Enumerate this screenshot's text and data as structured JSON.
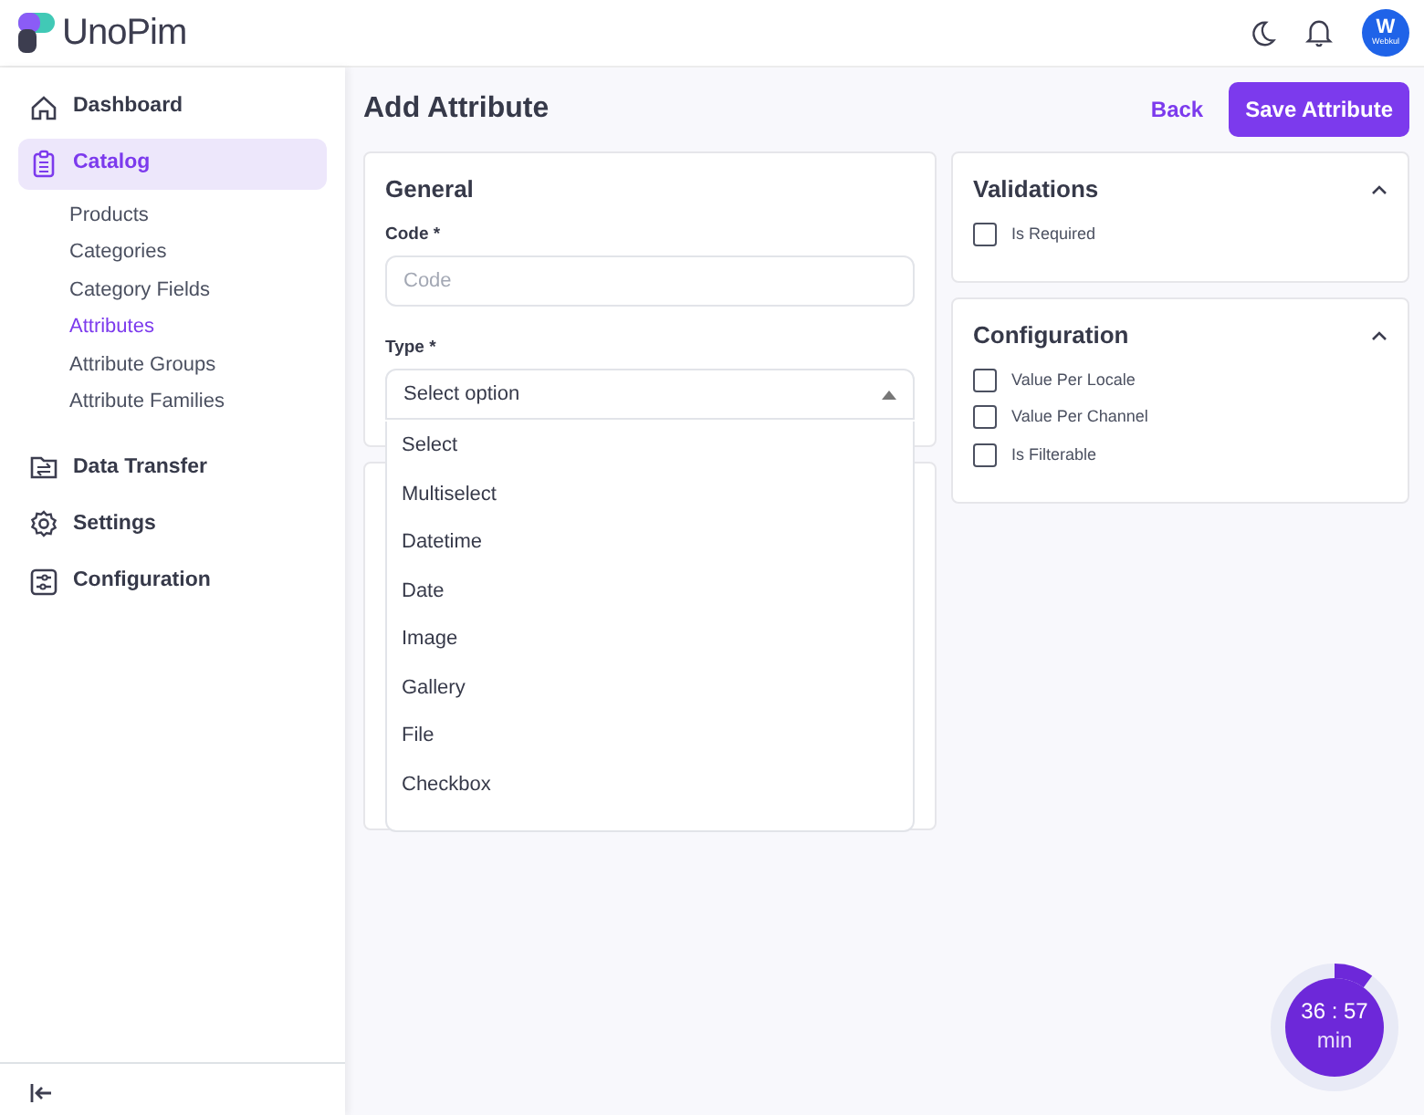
{
  "header": {
    "logo": "UnoPim",
    "avatar": {
      "letter": "W",
      "caption": "Webkul"
    }
  },
  "sidebar": {
    "items": [
      {
        "label": "Dashboard",
        "selected": false
      },
      {
        "label": "Catalog",
        "selected": true,
        "children": [
          {
            "label": "Products",
            "selected": false
          },
          {
            "label": "Categories",
            "selected": false
          },
          {
            "label": "Category Fields",
            "selected": false
          },
          {
            "label": "Attributes",
            "selected": true
          },
          {
            "label": "Attribute Groups",
            "selected": false
          },
          {
            "label": "Attribute Families",
            "selected": false
          }
        ]
      },
      {
        "label": "Data Transfer",
        "selected": false
      },
      {
        "label": "Settings",
        "selected": false
      },
      {
        "label": "Configuration",
        "selected": false
      }
    ]
  },
  "page": {
    "title": "Add Attribute",
    "back": "Back",
    "save": "Save Attribute"
  },
  "general": {
    "title": "General",
    "code_label": "Code *",
    "code_placeholder": "Code",
    "type_label": "Type *",
    "type_value": "Select option",
    "expanded": true,
    "options": [
      "Select",
      "Multiselect",
      "Datetime",
      "Date",
      "Image",
      "Gallery",
      "File",
      "Checkbox"
    ]
  },
  "validations": {
    "title": "Validations",
    "expanded": true,
    "checks": [
      {
        "label": "Is Required",
        "checked": false
      }
    ]
  },
  "configuration": {
    "title": "Configuration",
    "expanded": true,
    "checks": [
      {
        "label": "Value Per Locale",
        "checked": false
      },
      {
        "label": "Value Per Channel",
        "checked": false
      },
      {
        "label": "Is Filterable",
        "checked": false
      }
    ]
  },
  "timer": {
    "time": "36 : 57",
    "unit": "min",
    "level": 0.1
  }
}
